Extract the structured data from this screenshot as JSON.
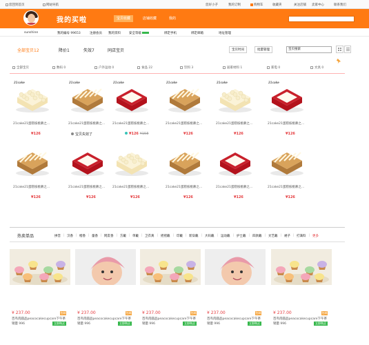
{
  "topbar": {
    "left": [
      "您回到首页",
      "网站导航"
    ],
    "right": [
      "您好小子",
      "我的订制",
      "购物车",
      "收藏夹",
      "关注店铺",
      "卖家中心",
      "联系我们"
    ]
  },
  "header": {
    "title": "我的买啦",
    "username": "sunshine",
    "tabs": [
      "宝贝收藏",
      "店铺收藏",
      "我的"
    ],
    "active_tab": "宝贝收藏",
    "search_placeholder": ""
  },
  "subnav": [
    "我的编号 99653",
    "注册会员",
    "我的资料",
    "安全等级",
    "绑定手机",
    "绑定邮箱",
    "地址管理"
  ],
  "toolbar": {
    "tabs": [
      "全部宝贝12",
      "降价1",
      "失效7",
      "同店宝贝"
    ],
    "active_tab": "全部宝贝12",
    "btn_sort": "宝贝时间",
    "btn_manage": "批量管理",
    "search_value": "宝贝搜索"
  },
  "filters": [
    "全部宝贝",
    "数码 0",
    "户外运动 0",
    "食品 22",
    "饮料 3",
    "居家材料 1",
    "家电 0",
    "文具 0"
  ],
  "products": [
    {
      "logo": "21cake",
      "name": "21cake21蛋糕核桃慕之...",
      "price": "¥126",
      "cake": "cream"
    },
    {
      "logo": "21cake",
      "name": "21cake21蛋糕核桃慕之...",
      "price": "",
      "note": "宝贝失效了",
      "cake": "nut"
    },
    {
      "logo": "21cake",
      "name": "21cake21蛋糕核桃慕之...",
      "price": "¥126",
      "old_price": "¥158",
      "cake": "berry"
    },
    {
      "logo": "21cake",
      "name": "21cake21蛋糕核桃慕之...",
      "price": "¥126",
      "cake": "nut"
    },
    {
      "logo": "21cake",
      "name": "21cake21蛋糕核桃慕之...",
      "price": "¥126",
      "cake": "cream"
    },
    {
      "logo": "21cake",
      "name": "21cake21蛋糕核桃慕之...",
      "price": "¥126",
      "cake": "berry"
    },
    {
      "logo": "",
      "name": "21cake21蛋糕核桃慕之...",
      "price": "¥126",
      "cake": "nut"
    },
    {
      "logo": "",
      "name": "21cake21蛋糕核桃慕之...",
      "price": "¥126",
      "cake": "berry"
    },
    {
      "logo": "",
      "name": "21cake21蛋糕核桃慕之...",
      "price": "¥126",
      "cake": "cream"
    },
    {
      "logo": "",
      "name": "21cake21蛋糕核桃慕之...",
      "price": "¥126",
      "cake": "nut"
    },
    {
      "logo": "",
      "name": "21cake21蛋糕核桃慕之...",
      "price": "¥126",
      "cake": "berry"
    },
    {
      "logo": "",
      "name": "21cake21蛋糕核桃慕之...",
      "price": "¥126",
      "cake": "nut"
    }
  ],
  "hot": {
    "title": "热卖单品",
    "cats": [
      "拼音",
      "汉香",
      "楷香",
      "童香",
      "网友香",
      "方戴",
      "单戴",
      "卫衣真",
      "摇摇戴",
      "印戴",
      "新穿戴",
      "大码戴",
      "运动戴",
      "护士戴",
      "四款戴",
      "文艺戴",
      "裙子",
      "打满料",
      "更多"
    ],
    "items": [
      {
        "price": "¥ 237.00",
        "tag": "包邮",
        "name": "百鸟肉圆品peacocakecupcare下午茶",
        "sales": "销量 996",
        "buy": "立即购买",
        "pic": "cupcake"
      },
      {
        "price": "¥ 237.00",
        "tag": "包邮",
        "name": "百鸟肉圆品peacocakecupcare下午茶",
        "sales": "销量 996",
        "buy": "立即购买",
        "pic": "baby"
      },
      {
        "price": "¥ 237.00",
        "tag": "包邮",
        "name": "百鸟肉圆品peacocakecupcare下午茶",
        "sales": "销量 996",
        "buy": "立即购买",
        "pic": "cupcake"
      },
      {
        "price": "¥ 237.00",
        "tag": "包邮",
        "name": "百鸟肉圆品peacocakecupcare下午茶",
        "sales": "销量 996",
        "buy": "立即购买",
        "pic": "baby"
      },
      {
        "price": "¥ 237.00",
        "tag": "包邮",
        "name": "百鸟肉圆品peacocakecupcare下午茶",
        "sales": "销量 996",
        "buy": "立即购买",
        "pic": "cupcake"
      }
    ]
  },
  "colors": {
    "brand": "#ff7a12",
    "price": "#e4393c",
    "buy": "#36b84c"
  }
}
